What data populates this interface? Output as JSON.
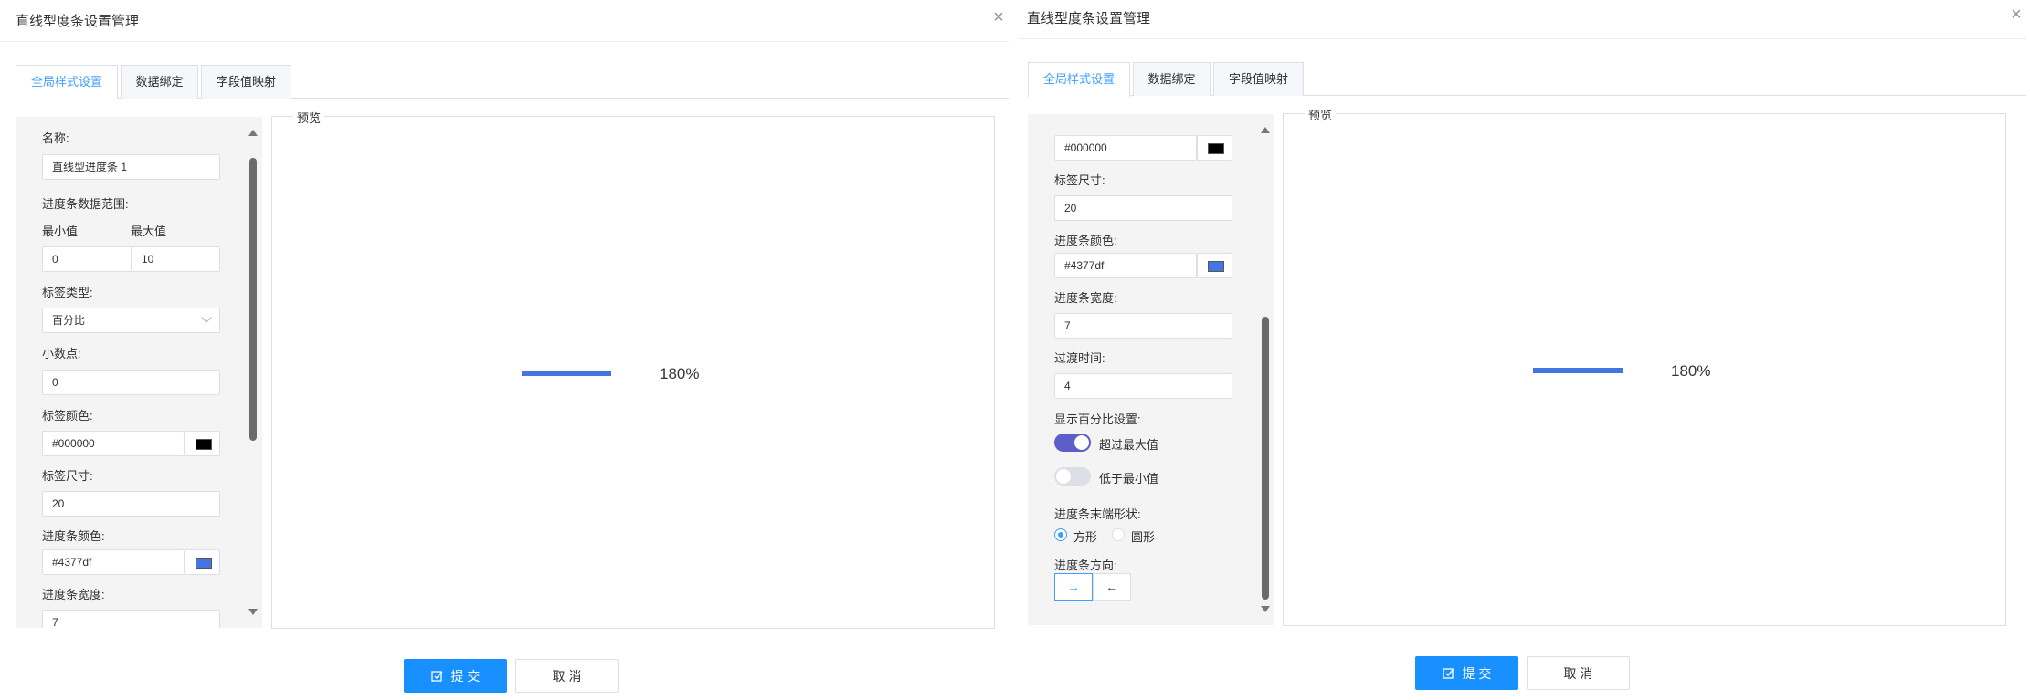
{
  "dialog_title": "直线型度条设置管理",
  "tabs": [
    "全局样式设置",
    "数据绑定",
    "字段值映射"
  ],
  "preview": {
    "legend": "预览",
    "bar_color": "#4377df",
    "bar_label": "180%"
  },
  "footer": {
    "submit_label": "提 交",
    "cancel_label": "取 消"
  },
  "colors": {
    "primary": "#1890ff",
    "tab_active": "#409eff",
    "switch_on": "#5b5fc7",
    "panel_bg": "#f4f4f5"
  },
  "left_form": {
    "name_label": "名称:",
    "name_value": "直线型进度条 1",
    "range_label": "进度条数据范围:",
    "min_label": "最小值",
    "max_label": "最大值",
    "min_value": "0",
    "max_value": "10",
    "label_type_label": "标签类型:",
    "label_type_value": "百分比",
    "decimal_label": "小数点:",
    "decimal_value": "0",
    "label_color_label": "标签颜色:",
    "label_color_value": "#000000",
    "label_color_swatch": "#000000",
    "label_size_label": "标签尺寸:",
    "label_size_value": "20",
    "bar_color_label": "进度条颜色:",
    "bar_color_value": "#4377df",
    "bar_color_swatch": "#4377df",
    "bar_width_label": "进度条宽度:",
    "bar_width_value": "7"
  },
  "right_form": {
    "label_color_value": "#000000",
    "label_color_swatch": "#000000",
    "label_size_label": "标签尺寸:",
    "label_size_value": "20",
    "bar_color_label": "进度条颜色:",
    "bar_color_value": "#4377df",
    "bar_color_swatch": "#4377df",
    "bar_width_label": "进度条宽度:",
    "bar_width_value": "7",
    "transition_label": "过渡时间:",
    "transition_value": "4",
    "percent_display_label": "显示百分比设置:",
    "over_max_label": "超过最大值",
    "under_min_label": "低于最小值",
    "end_shape_label": "进度条末端形状:",
    "shape_square_label": "方形",
    "shape_round_label": "圆形",
    "direction_label": "进度条方向:",
    "dir_right_icon": "→",
    "dir_left_icon": "←"
  }
}
